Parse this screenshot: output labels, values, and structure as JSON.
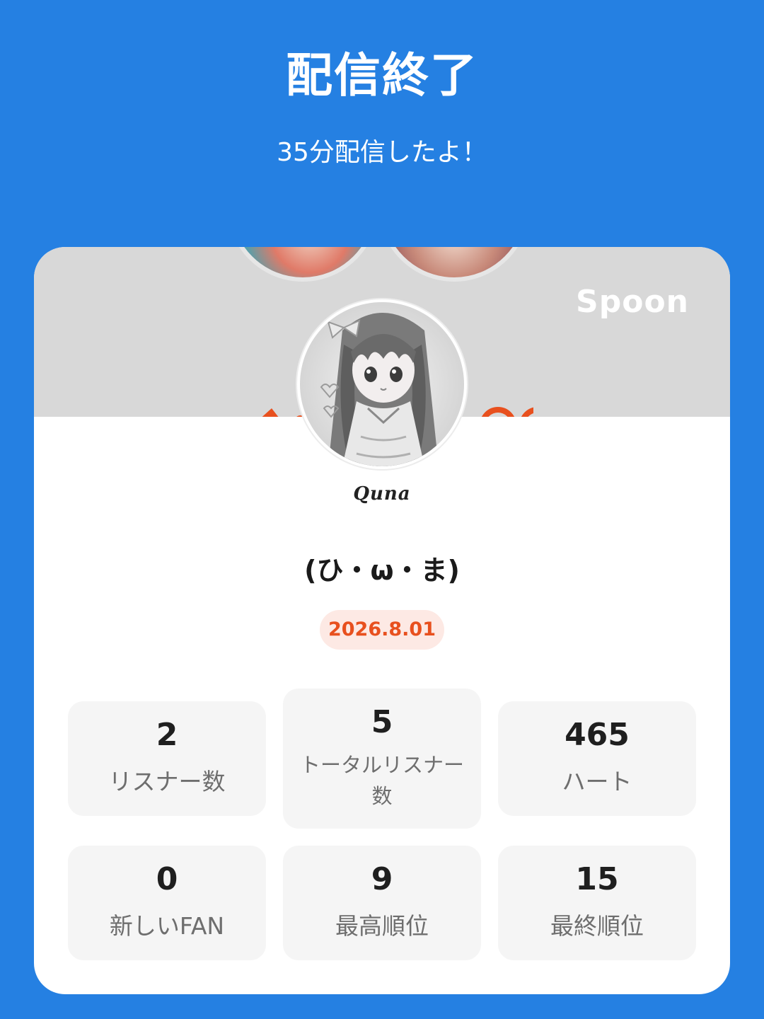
{
  "header": {
    "title": "配信終了",
    "subtitle": "35分配信したよ！"
  },
  "card": {
    "brand_logo": "Spoon",
    "signature": "Quna",
    "username": "(ひ・ω・ま)",
    "date": "2026.8.01",
    "stats": [
      {
        "value": "2",
        "label": "リスナー数"
      },
      {
        "value": "5",
        "label": "トータルリスナー数"
      },
      {
        "value": "465",
        "label": "ハート"
      },
      {
        "value": "0",
        "label": "新しいFAN"
      },
      {
        "value": "9",
        "label": "最高順位"
      },
      {
        "value": "15",
        "label": "最終順位"
      }
    ]
  },
  "colors": {
    "background": "#2580e2",
    "date_badge_text": "#e8501e",
    "date_badge_bg": "#fde9e4"
  }
}
